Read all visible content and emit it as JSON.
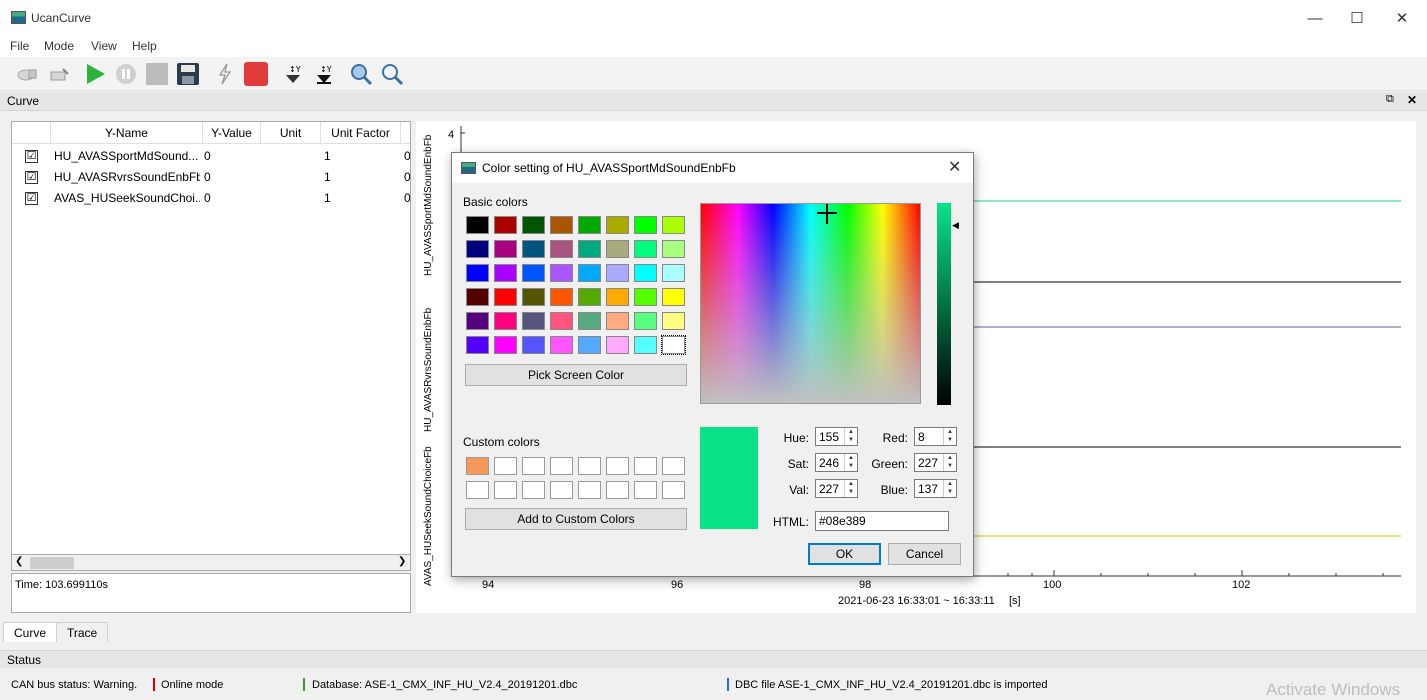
{
  "app": {
    "title": "UcanCurve",
    "window_controls": {
      "minimize": "—",
      "maximize": "☐",
      "close": "✕"
    }
  },
  "menu": [
    "File",
    "Mode",
    "View",
    "Help"
  ],
  "toolbar": {
    "icons": [
      "connect-icon",
      "disconnect-icon",
      "play-icon",
      "pause-icon",
      "stop-icon",
      "save-icon",
      "trigger-icon",
      "record-icon",
      "y-axis-down-icon",
      "y-axis-up-icon",
      "zoom-in-icon",
      "zoom-out-icon"
    ]
  },
  "dock": {
    "title": "Curve",
    "float": "⧉",
    "close": "✕"
  },
  "table": {
    "columns": [
      "Y-Name",
      "Y-Value",
      "Unit",
      "Unit Factor",
      ""
    ],
    "rows": [
      {
        "checked": "☑",
        "name": "HU_AVASSportMdSound...",
        "value": "0",
        "unit": "",
        "factor": "1",
        "offset": "0"
      },
      {
        "checked": "☑",
        "name": "HU_AVASRvrsSoundEnbFb",
        "value": "0",
        "unit": "",
        "factor": "1",
        "offset": "0"
      },
      {
        "checked": "☑",
        "name": "AVAS_HUSeekSoundChoi...",
        "value": "0",
        "unit": "",
        "factor": "1",
        "offset": "0"
      }
    ],
    "time_label": "Time: 103.699110s"
  },
  "plot": {
    "y_axis_labels": [
      "HU_AVASSportMdSoundEnbFb",
      "HU_AVASRvrsSoundEnbFb",
      "AVAS_HUSeekSoundChoiceFb"
    ],
    "y_tick_top": "4",
    "x_ticks": [
      "94",
      "96",
      "98",
      "100",
      "102"
    ],
    "x_range_label": "2021-06-23 16:33:01 ~ 16:33:11",
    "x_unit": "[s]"
  },
  "dialog": {
    "title": "Color setting of HU_AVASSportMdSoundEnbFb",
    "close": "✕",
    "basic_colors_label": "Basic colors",
    "basic_colors": [
      [
        "#000000",
        "#aa0000",
        "#005500",
        "#aa5500",
        "#00aa00",
        "#aaaa00",
        "#00ff00",
        "#aaff00"
      ],
      [
        "#00007f",
        "#aa007f",
        "#00557f",
        "#aa557f",
        "#00aa7f",
        "#aaaa7f",
        "#00ff7f",
        "#aaff7f"
      ],
      [
        "#0000ff",
        "#aa00ff",
        "#0055ff",
        "#aa55ff",
        "#00aaff",
        "#aaaaff",
        "#00ffff",
        "#aaffff"
      ],
      [
        "#550000",
        "#ff0000",
        "#555500",
        "#ff5500",
        "#55aa00",
        "#ffaa00",
        "#55ff00",
        "#ffff00"
      ],
      [
        "#55007f",
        "#ff007f",
        "#55557f",
        "#ff557f",
        "#55aa7f",
        "#ffaa7f",
        "#55ff7f",
        "#ffff7f"
      ],
      [
        "#5500ff",
        "#ff00ff",
        "#5555ff",
        "#ff55ff",
        "#55aaff",
        "#ffaaff",
        "#55ffff",
        "#ffffff"
      ]
    ],
    "pick_screen_label": "Pick Screen Color",
    "custom_colors_label": "Custom colors",
    "custom_colors": [
      [
        "#f4995a",
        "#ffffff",
        "#ffffff",
        "#ffffff",
        "#ffffff",
        "#ffffff",
        "#ffffff",
        "#ffffff"
      ],
      [
        "#ffffff",
        "#ffffff",
        "#ffffff",
        "#ffffff",
        "#ffffff",
        "#ffffff",
        "#ffffff",
        "#ffffff"
      ]
    ],
    "add_custom_label": "Add to Custom Colors",
    "current_color": "#08e389",
    "fields": {
      "hue_label": "Hue:",
      "hue": "155",
      "sat_label": "Sat:",
      "sat": "246",
      "val_label": "Val:",
      "val": "227",
      "red_label": "Red:",
      "red": "8",
      "green_label": "Green:",
      "green": "227",
      "blue_label": "Blue:",
      "blue": "137",
      "html_label": "HTML:",
      "html": "#08e389"
    },
    "ok_label": "OK",
    "cancel_label": "Cancel"
  },
  "tabs": [
    "Curve",
    "Trace"
  ],
  "status": {
    "title": "Status",
    "items": [
      {
        "text": "CAN bus status: Warning.",
        "color": ""
      },
      {
        "text": "Online mode",
        "color": "#d00000"
      },
      {
        "text": "Database: ASE-1_CMX_INF_HU_V2.4_20191201.dbc",
        "color": "#3a9a2a"
      },
      {
        "text": "DBC file ASE-1_CMX_INF_HU_V2.4_20191201.dbc is imported",
        "color": "#1e6fd0"
      }
    ],
    "watermark": "Activate Windows"
  }
}
